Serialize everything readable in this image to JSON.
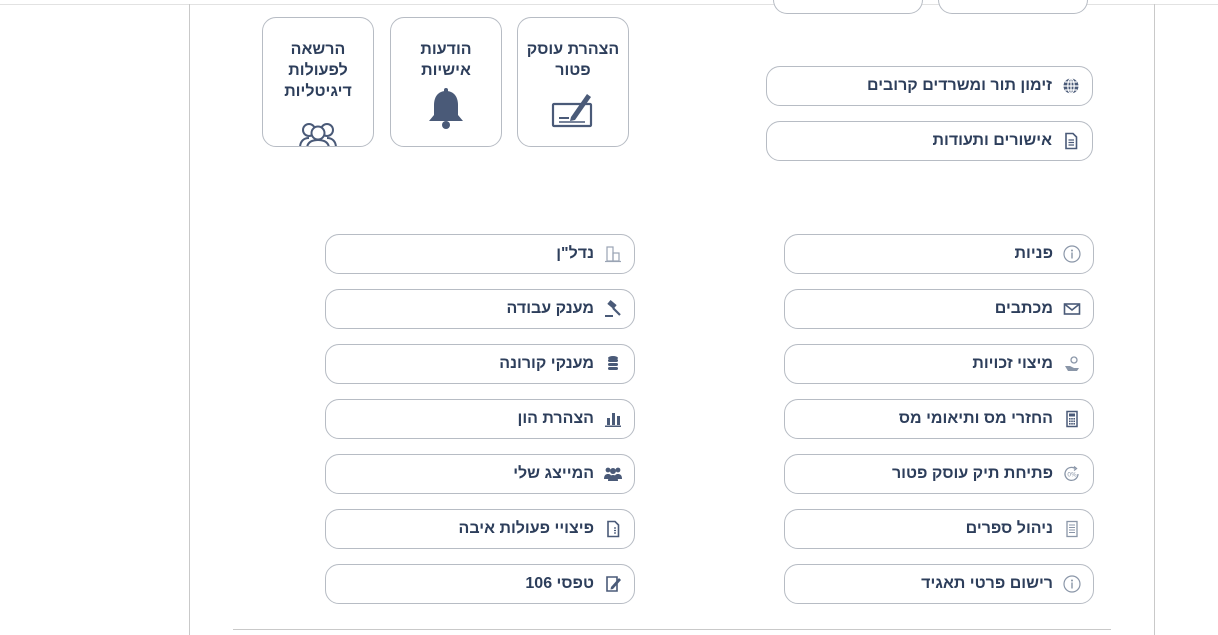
{
  "colors": {
    "text": "#2d3e5b",
    "border": "#b7bcc4",
    "icon": "#4a5a78"
  },
  "cards": [
    {
      "id": "exempt",
      "label": "הצהרת עוסק פטור",
      "icon": "check-pen-icon"
    },
    {
      "id": "messages",
      "label": "הודעות אישיות",
      "icon": "bell-icon"
    },
    {
      "id": "authorization",
      "label": "הרשאה לפעולות דיגיטליות",
      "icon": "users-icon"
    }
  ],
  "top_links": [
    {
      "label": "זימון תור ומשרדים קרובים",
      "icon": "globe-icon"
    },
    {
      "label": "אישורים ותעודות",
      "icon": "document-icon"
    }
  ],
  "right_column": [
    {
      "label": "פניות",
      "icon": "info-icon"
    },
    {
      "label": "מכתבים",
      "icon": "envelope-icon"
    },
    {
      "label": "מיצוי זכויות",
      "icon": "hand-coin-icon"
    },
    {
      "label": "החזרי מס ותיאומי מס",
      "icon": "calculator-icon"
    },
    {
      "label": "פתיחת תיק עוסק פטור",
      "icon": "percent-refresh-icon"
    },
    {
      "label": "ניהול ספרים",
      "icon": "ledger-icon"
    },
    {
      "label": "רישום פרטי תאגיד",
      "icon": "info-icon"
    }
  ],
  "left_column": [
    {
      "label": "נדל\"ן",
      "icon": "building-icon"
    },
    {
      "label": "מענק עבודה",
      "icon": "gavel-icon"
    },
    {
      "label": "מענקי קורונה",
      "icon": "coins-icon"
    },
    {
      "label": "הצהרת הון",
      "icon": "bar-chart-icon"
    },
    {
      "label": "המייצג שלי",
      "icon": "group-icon"
    },
    {
      "label": "פיצויי פעולות איבה",
      "icon": "document-icon"
    },
    {
      "label": "טפסי 106",
      "icon": "form-edit-icon"
    }
  ]
}
